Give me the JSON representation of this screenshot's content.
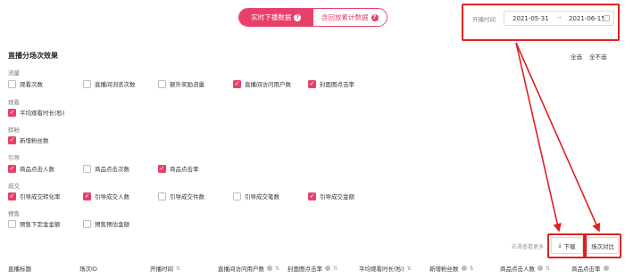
{
  "toggle": {
    "realtime_label": "实时下播数据",
    "cumulative_label": "含回放累计数据",
    "help_mark": "?"
  },
  "date": {
    "label": "开播时间",
    "start": "2021-05-31",
    "separator": "→",
    "end": "2021-06-15"
  },
  "section": {
    "title": "直播分场次效果",
    "select_all": "全选",
    "select_none": "全不选"
  },
  "groups": [
    {
      "label": "流量",
      "options": [
        {
          "label": "观看次数",
          "checked": false
        },
        {
          "label": "直播间浏览次数",
          "checked": false
        },
        {
          "label": "额外奖励流量",
          "checked": false
        },
        {
          "label": "直播间访问用户数",
          "checked": true
        },
        {
          "label": "封面图点击率",
          "checked": true
        }
      ]
    },
    {
      "label": "观看",
      "options": [
        {
          "label": "平均观看时长(秒)",
          "checked": true
        }
      ]
    },
    {
      "label": "转粉",
      "options": [
        {
          "label": "新增粉丝数",
          "checked": true
        }
      ]
    },
    {
      "label": "引导",
      "options": [
        {
          "label": "商品点击人数",
          "checked": true
        },
        {
          "label": "商品点击次数",
          "checked": false
        },
        {
          "label": "商品点击率",
          "checked": true
        }
      ]
    },
    {
      "label": "成交",
      "options": [
        {
          "label": "引导成交转化率",
          "checked": true
        },
        {
          "label": "引导成交人数",
          "checked": true
        },
        {
          "label": "引导成交件数",
          "checked": false
        },
        {
          "label": "引导成交笔数",
          "checked": false
        },
        {
          "label": "引导成交金额",
          "checked": true
        }
      ]
    },
    {
      "label": "预售",
      "options": [
        {
          "label": "预售下定金金额",
          "checked": false
        },
        {
          "label": "预售预估金额",
          "checked": false
        }
      ]
    }
  ],
  "actions": {
    "scroll_hint": "右滑查看更多",
    "download_label": "下载",
    "compare_label": "场次对比"
  },
  "table": {
    "headers": [
      "直播标题",
      "场次ID",
      "开播时间",
      "直播间访问用户数",
      "封面图点击率",
      "平均观看时长(秒)",
      "新增粉丝数",
      "商品点击人数",
      "商品点击率"
    ]
  },
  "colors": {
    "accent": "#e8406a",
    "annotation": "#e02020"
  }
}
